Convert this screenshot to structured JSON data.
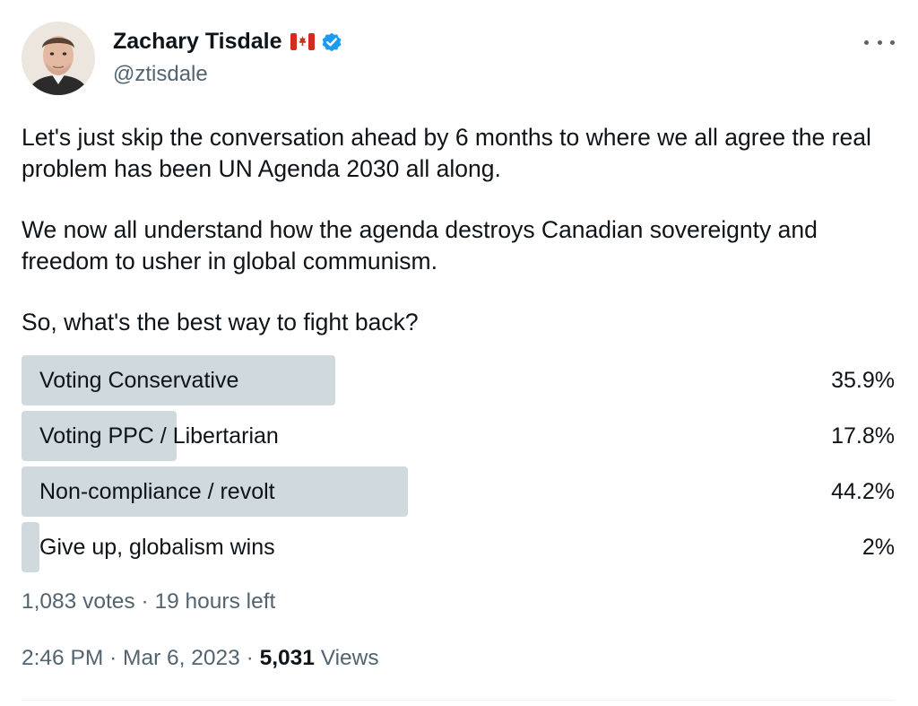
{
  "author": {
    "display_name": "Zachary Tisdale",
    "handle": "@ztisdale",
    "flag_icon": "canada-flag-icon",
    "verified_icon": "verified-badge-icon",
    "verified_color": "#1d9bf0"
  },
  "tweet": {
    "paragraphs": [
      "Let's just skip the conversation ahead by 6 months to where we all agree the real problem has been UN Agenda 2030 all along.",
      "We now all understand how the agenda destroys Canadian sovereignty and freedom to usher in global communism.",
      "So, what's the best way to fight back?"
    ]
  },
  "poll": {
    "bar_color": "#cfd9de",
    "options": [
      {
        "label": "Voting Conservative",
        "percent_text": "35.9%",
        "percent": 35.9
      },
      {
        "label": "Voting PPC / Libertarian",
        "percent_text": "17.8%",
        "percent": 17.8
      },
      {
        "label": "Non-compliance / revolt",
        "percent_text": "44.2%",
        "percent": 44.2
      },
      {
        "label": "Give up, globalism wins",
        "percent_text": "2%",
        "percent": 2
      }
    ],
    "votes": "1,083 votes",
    "separator": "·",
    "time_left": "19 hours left"
  },
  "meta": {
    "time": "2:46 PM",
    "separator": "·",
    "date": "Mar 6, 2023",
    "views_count": "5,031",
    "views_label": "Views"
  },
  "more_icon": "more-options-icon"
}
